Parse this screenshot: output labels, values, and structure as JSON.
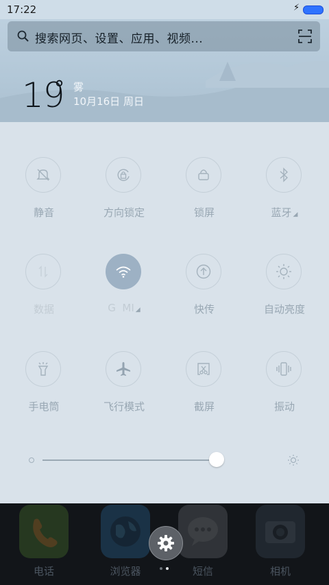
{
  "status_bar": {
    "time": "17:22"
  },
  "search": {
    "placeholder": "搜索网页、设置、应用、视频..."
  },
  "weather": {
    "temperature": "19",
    "degree_mark": "°",
    "condition": "雾",
    "date": "10月16日 周日"
  },
  "toggles": [
    {
      "label": "静音",
      "icon": "silent-bell-icon",
      "active": false
    },
    {
      "label": "方向锁定",
      "icon": "rotation-lock-icon",
      "active": false
    },
    {
      "label": "锁屏",
      "icon": "lock-icon",
      "active": false
    },
    {
      "label": "蓝牙",
      "icon": "bluetooth-icon",
      "active": false,
      "has_menu": true
    },
    {
      "label": "数据",
      "icon": "data-arrows-icon",
      "active": false,
      "disabled": true
    },
    {
      "label": "G  MI",
      "icon": "wifi-icon",
      "active": true,
      "has_menu": true
    },
    {
      "label": "快传",
      "icon": "fast-transfer-icon",
      "active": false
    },
    {
      "label": "自动亮度",
      "icon": "auto-brightness-icon",
      "active": false
    },
    {
      "label": "手电筒",
      "icon": "flashlight-icon",
      "active": false
    },
    {
      "label": "飞行模式",
      "icon": "airplane-icon",
      "active": false
    },
    {
      "label": "截屏",
      "icon": "screenshot-icon",
      "active": false
    },
    {
      "label": "振动",
      "icon": "vibrate-icon",
      "active": false
    }
  ],
  "brightness": {
    "level": 0.97
  },
  "dock": {
    "apps": [
      {
        "label": "电话",
        "icon": "phone-icon",
        "color": "#4b7a2e"
      },
      {
        "label": "浏览器",
        "icon": "browser-icon",
        "color": "#2a6a9a"
      },
      {
        "label": "短信",
        "icon": "messages-icon",
        "color": "#6a6d72"
      },
      {
        "label": "相机",
        "icon": "camera-icon",
        "color": "#3c4a58"
      }
    ]
  },
  "colors": {
    "wifi_active": "#9db1c4",
    "battery": "#2f73ff"
  }
}
